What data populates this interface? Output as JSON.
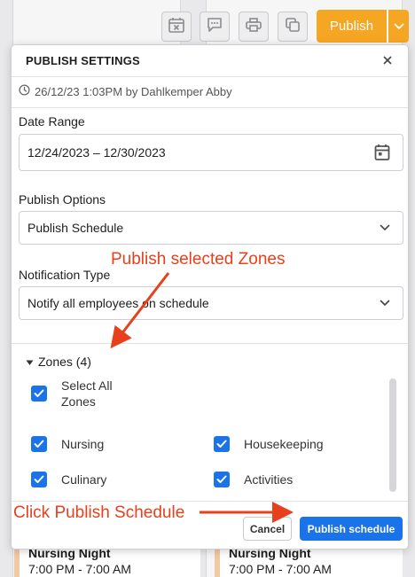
{
  "toolbar": {
    "publish_label": "Publish"
  },
  "background": {
    "cards": [
      {
        "title": "Nursing Night",
        "time": "7:00 PM - 7:00 AM"
      },
      {
        "title": "Nursing Night",
        "time": "7:00 PM - 7:00 AM"
      }
    ]
  },
  "dialog": {
    "title": "PUBLISH SETTINGS",
    "meta": "26/12/23 1:03PM by Dahlkemper Abby",
    "date_range": {
      "label": "Date Range",
      "value": "12/24/2023 – 12/30/2023"
    },
    "publish_options": {
      "label": "Publish Options",
      "value": "Publish Schedule"
    },
    "notification_type": {
      "label": "Notification Type",
      "value": "Notify all employees on schedule"
    },
    "zones": {
      "header": "Zones (4)",
      "select_all": "Select All Zones",
      "items": [
        "Nursing",
        "Housekeeping",
        "Culinary",
        "Activities"
      ]
    },
    "cancel_label": "Cancel",
    "publish_schedule_label": "Publish schedule"
  },
  "annotations": {
    "zones_note": "Publish selected Zones",
    "publish_note": "Click Publish Schedule"
  },
  "colors": {
    "accent_orange": "#f5a623",
    "primary_blue": "#1a73e8",
    "annotation_red": "#e8401c"
  }
}
